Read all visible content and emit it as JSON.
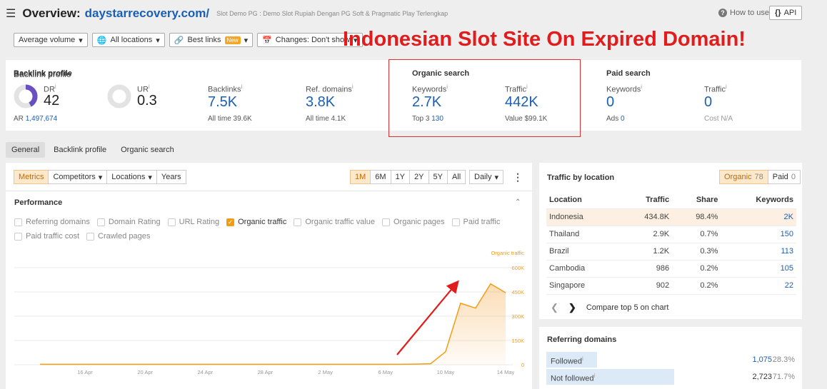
{
  "header": {
    "title_label": "Overview:",
    "domain": "daystarrecovery.com/",
    "subtitle": "Slot Demo PG : Demo Slot Rupiah Dengan PG Soft & Pragmatic Play Terlengkap",
    "how_to_use": "How to use",
    "api_label": "API",
    "api_icon": "{}"
  },
  "filters": [
    {
      "label": "Average volume",
      "icon": ""
    },
    {
      "label": "All locations",
      "icon": "globe-icon"
    },
    {
      "label": "Best links",
      "icon": "link-icon",
      "badge": "New"
    },
    {
      "label": "Changes: Don't show",
      "icon": "calendar-icon"
    }
  ],
  "banner": "Indonesian Slot Site On Expired Domain!",
  "backlink_profile": {
    "title": "Backlink profile",
    "dr_label": "DR",
    "dr_value": "42",
    "dr_fraction": 0.42,
    "ur_label": "UR",
    "ur_value": "0.3",
    "ar_label": "AR",
    "ar_value": "1,497,674",
    "backlinks_label": "Backlinks",
    "backlinks_value": "7.5K",
    "backlinks_sub": "All time 39.6K",
    "refdomains_label": "Ref. domains",
    "refdomains_value": "3.8K",
    "refdomains_sub": "All time 4.1K"
  },
  "organic_search": {
    "title": "Organic search",
    "keywords_label": "Keywords",
    "keywords_value": "2.7K",
    "top3_label": "Top 3",
    "top3_value": "130",
    "traffic_label": "Traffic",
    "traffic_value": "442K",
    "traffic_sub": "Value $99.1K"
  },
  "paid_search": {
    "title": "Paid search",
    "keywords_label": "Keywords",
    "keywords_value": "0",
    "ads_label": "Ads",
    "ads_value": "0",
    "traffic_label": "Traffic",
    "traffic_value": "0",
    "cost_label": "Cost N/A"
  },
  "tabs": [
    "General",
    "Backlink profile",
    "Organic search"
  ],
  "chart_controls": {
    "views": [
      "Metrics",
      "Competitors",
      "Locations",
      "Years"
    ],
    "ranges": [
      "1M",
      "6M",
      "1Y",
      "2Y",
      "5Y",
      "All"
    ],
    "granularity": "Daily"
  },
  "performance": {
    "title": "Performance",
    "checkboxes": [
      {
        "label": "Referring domains",
        "checked": false
      },
      {
        "label": "Domain Rating",
        "checked": false
      },
      {
        "label": "URL Rating",
        "checked": false
      },
      {
        "label": "Organic traffic",
        "checked": true
      },
      {
        "label": "Organic traffic value",
        "checked": false
      },
      {
        "label": "Organic pages",
        "checked": false
      },
      {
        "label": "Paid traffic",
        "checked": false
      },
      {
        "label": "Paid traffic cost",
        "checked": false
      },
      {
        "label": "Crawled pages",
        "checked": false
      }
    ]
  },
  "chart_data": {
    "type": "area",
    "series": [
      {
        "name": "Organic traffic",
        "color": "#f39c12"
      }
    ],
    "y_ticks": [
      "600K",
      "450K",
      "300K",
      "150K",
      "0"
    ],
    "ylim": [
      0,
      600000
    ],
    "x_tick_labels": [
      "16 Apr",
      "20 Apr",
      "24 Apr",
      "28 Apr",
      "2 May",
      "6 May",
      "10 May",
      "14 May"
    ],
    "x": [
      "13 Apr",
      "14 Apr",
      "15 Apr",
      "16 Apr",
      "17 Apr",
      "18 Apr",
      "19 Apr",
      "20 Apr",
      "21 Apr",
      "22 Apr",
      "23 Apr",
      "24 Apr",
      "25 Apr",
      "26 Apr",
      "27 Apr",
      "28 Apr",
      "29 Apr",
      "30 Apr",
      "1 May",
      "2 May",
      "3 May",
      "4 May",
      "5 May",
      "6 May",
      "7 May",
      "8 May",
      "9 May",
      "10 May",
      "11 May",
      "12 May",
      "13 May",
      "14 May"
    ],
    "values": [
      3000,
      3000,
      3000,
      3000,
      3000,
      3000,
      3000,
      3000,
      3000,
      3000,
      3000,
      3000,
      3000,
      3000,
      3000,
      3000,
      3000,
      3000,
      3000,
      3000,
      3000,
      3000,
      3000,
      3000,
      3000,
      4000,
      6000,
      80000,
      380000,
      350000,
      500000,
      445000
    ]
  },
  "traffic_by_location": {
    "title": "Traffic by location",
    "organic_label": "Organic",
    "organic_count": "78",
    "paid_label": "Paid",
    "paid_count": "0",
    "columns": [
      "Location",
      "Traffic",
      "Share",
      "Keywords"
    ],
    "rows": [
      {
        "location": "Indonesia",
        "traffic": "434.8K",
        "share": "98.4%",
        "keywords": "2K"
      },
      {
        "location": "Thailand",
        "traffic": "2.9K",
        "share": "0.7%",
        "keywords": "150"
      },
      {
        "location": "Brazil",
        "traffic": "1.2K",
        "share": "0.3%",
        "keywords": "113"
      },
      {
        "location": "Cambodia",
        "traffic": "986",
        "share": "0.2%",
        "keywords": "105"
      },
      {
        "location": "Singapore",
        "traffic": "902",
        "share": "0.2%",
        "keywords": "22"
      }
    ],
    "compare_label": "Compare top 5 on chart"
  },
  "referring_domains": {
    "title": "Referring domains",
    "rows": [
      {
        "label": "Followed",
        "value": "1,075",
        "pct": "28.3%",
        "fraction": 0.283
      },
      {
        "label": "Not followed",
        "value": "2,723",
        "pct": "71.7%",
        "fraction": 0.717
      }
    ]
  }
}
